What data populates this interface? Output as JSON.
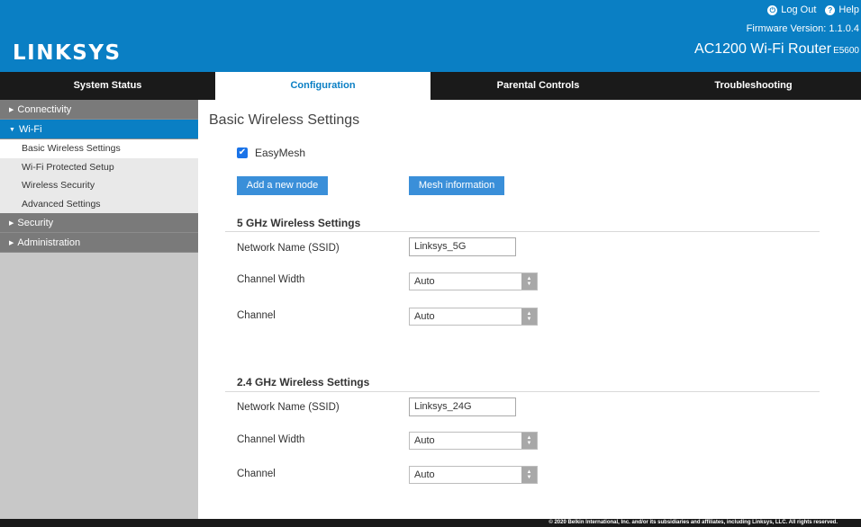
{
  "header": {
    "logo": "LINKSYS",
    "log_out": "Log Out",
    "help": "Help",
    "firmware": "Firmware Version: 1.1.0.4",
    "model": "AC1200 Wi-Fi Router",
    "model_number": "E5600",
    "colors": {
      "header_bg": "#0a7fc4",
      "nav_bg": "#1a1a1a"
    }
  },
  "nav": {
    "tabs": [
      {
        "label": "System Status"
      },
      {
        "label": "Configuration"
      },
      {
        "label": "Parental Controls"
      },
      {
        "label": "Troubleshooting"
      }
    ],
    "active": "Configuration"
  },
  "sidebar": {
    "connectivity": "Connectivity",
    "wifi": "Wi-Fi",
    "wifi_items": [
      {
        "label": "Basic Wireless Settings"
      },
      {
        "label": "Wi-Fi Protected Setup"
      },
      {
        "label": "Wireless Security"
      },
      {
        "label": "Advanced Settings"
      }
    ],
    "security": "Security",
    "administration": "Administration"
  },
  "main": {
    "title": "Basic Wireless Settings",
    "easymesh_label": "EasyMesh",
    "easymesh_checked": true,
    "add_node_button": "Add a new node",
    "mesh_info_button": "Mesh information",
    "band5": {
      "title": "5 GHz Wireless Settings",
      "ssid_label": "Network Name (SSID)",
      "ssid_value": "Linksys_5G",
      "width_label": "Channel Width",
      "width_value": "Auto",
      "channel_label": "Channel",
      "channel_value": "Auto"
    },
    "band24": {
      "title": "2.4 GHz Wireless Settings",
      "ssid_label": "Network Name (SSID)",
      "ssid_value": "Linksys_24G",
      "width_label": "Channel Width",
      "width_value": "Auto",
      "channel_label": "Channel",
      "channel_value": "Auto"
    }
  },
  "footer": {
    "copyright": "© 2020 Belkin International, Inc. and/or its subsidiaries and affiliates, including Linksys, LLC. All rights reserved."
  }
}
